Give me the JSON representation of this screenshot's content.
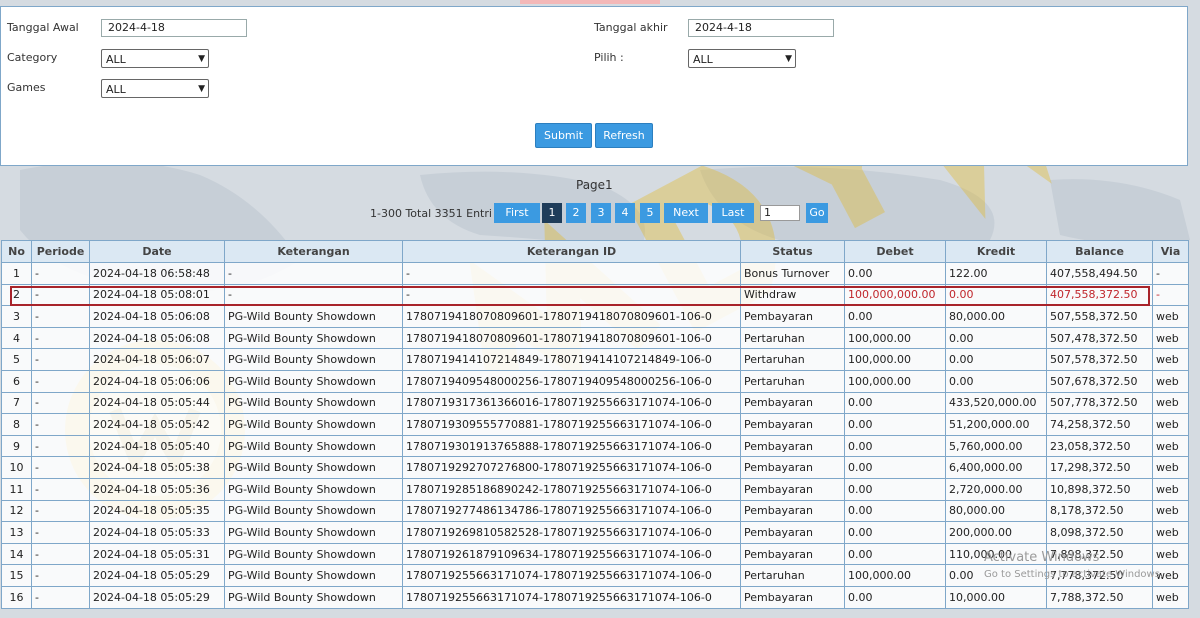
{
  "filters": {
    "tanggal_awal_label": "Tanggal Awal",
    "tanggal_awal_value": "2024-4-18",
    "tanggal_akhir_label": "Tanggal akhir",
    "tanggal_akhir_value": "2024-4-18",
    "category_label": "Category",
    "category_value": "ALL",
    "pilih_label": "Pilih :",
    "pilih_value": "ALL",
    "games_label": "Games",
    "games_value": "ALL",
    "submit_label": "Submit",
    "refresh_label": "Refresh"
  },
  "pagination": {
    "page_label": "Page1",
    "total_label": "1-300 Total 3351 Entri",
    "first": "First",
    "pages": [
      "1",
      "2",
      "3",
      "4",
      "5"
    ],
    "current_page": "1",
    "next": "Next",
    "last": "Last",
    "goto_value": "1",
    "go": "Go"
  },
  "table": {
    "headers": [
      "No",
      "Periode",
      "Date",
      "Keterangan",
      "Keterangan ID",
      "Status",
      "Debet",
      "Kredit",
      "Balance",
      "Via"
    ],
    "rows": [
      [
        "1",
        "-",
        "2024-04-18 06:58:48",
        "-",
        "-",
        "Bonus Turnover",
        "0.00",
        "122.00",
        "407,558,494.50",
        "-"
      ],
      [
        "2",
        "-",
        "2024-04-18 05:08:01",
        "-",
        "-",
        "Withdraw",
        "100,000,000.00",
        "0.00",
        "407,558,372.50",
        "-"
      ],
      [
        "3",
        "-",
        "2024-04-18 05:06:08",
        "PG-Wild Bounty Showdown",
        "1780719418070809601-1780719418070809601-106-0",
        "Pembayaran",
        "0.00",
        "80,000.00",
        "507,558,372.50",
        "web"
      ],
      [
        "4",
        "-",
        "2024-04-18 05:06:08",
        "PG-Wild Bounty Showdown",
        "1780719418070809601-1780719418070809601-106-0",
        "Pertaruhan",
        "100,000.00",
        "0.00",
        "507,478,372.50",
        "web"
      ],
      [
        "5",
        "-",
        "2024-04-18 05:06:07",
        "PG-Wild Bounty Showdown",
        "1780719414107214849-1780719414107214849-106-0",
        "Pertaruhan",
        "100,000.00",
        "0.00",
        "507,578,372.50",
        "web"
      ],
      [
        "6",
        "-",
        "2024-04-18 05:06:06",
        "PG-Wild Bounty Showdown",
        "1780719409548000256-1780719409548000256-106-0",
        "Pertaruhan",
        "100,000.00",
        "0.00",
        "507,678,372.50",
        "web"
      ],
      [
        "7",
        "-",
        "2024-04-18 05:05:44",
        "PG-Wild Bounty Showdown",
        "1780719317361366016-1780719255663171074-106-0",
        "Pembayaran",
        "0.00",
        "433,520,000.00",
        "507,778,372.50",
        "web"
      ],
      [
        "8",
        "-",
        "2024-04-18 05:05:42",
        "PG-Wild Bounty Showdown",
        "1780719309555770881-1780719255663171074-106-0",
        "Pembayaran",
        "0.00",
        "51,200,000.00",
        "74,258,372.50",
        "web"
      ],
      [
        "9",
        "-",
        "2024-04-18 05:05:40",
        "PG-Wild Bounty Showdown",
        "1780719301913765888-1780719255663171074-106-0",
        "Pembayaran",
        "0.00",
        "5,760,000.00",
        "23,058,372.50",
        "web"
      ],
      [
        "10",
        "-",
        "2024-04-18 05:05:38",
        "PG-Wild Bounty Showdown",
        "1780719292707276800-1780719255663171074-106-0",
        "Pembayaran",
        "0.00",
        "6,400,000.00",
        "17,298,372.50",
        "web"
      ],
      [
        "11",
        "-",
        "2024-04-18 05:05:36",
        "PG-Wild Bounty Showdown",
        "1780719285186890242-1780719255663171074-106-0",
        "Pembayaran",
        "0.00",
        "2,720,000.00",
        "10,898,372.50",
        "web"
      ],
      [
        "12",
        "-",
        "2024-04-18 05:05:35",
        "PG-Wild Bounty Showdown",
        "1780719277486134786-1780719255663171074-106-0",
        "Pembayaran",
        "0.00",
        "80,000.00",
        "8,178,372.50",
        "web"
      ],
      [
        "13",
        "-",
        "2024-04-18 05:05:33",
        "PG-Wild Bounty Showdown",
        "1780719269810582528-1780719255663171074-106-0",
        "Pembayaran",
        "0.00",
        "200,000.00",
        "8,098,372.50",
        "web"
      ],
      [
        "14",
        "-",
        "2024-04-18 05:05:31",
        "PG-Wild Bounty Showdown",
        "1780719261879109634-1780719255663171074-106-0",
        "Pembayaran",
        "0.00",
        "110,000.00",
        "7,898,372.50",
        "web"
      ],
      [
        "15",
        "-",
        "2024-04-18 05:05:29",
        "PG-Wild Bounty Showdown",
        "1780719255663171074-1780719255663171074-106-0",
        "Pertaruhan",
        "100,000.00",
        "0.00",
        "7,778,372.50",
        "web"
      ],
      [
        "16",
        "-",
        "2024-04-18 05:05:29",
        "PG-Wild Bounty Showdown",
        "1780719255663171074-1780719255663171074-106-0",
        "Pembayaran",
        "0.00",
        "10,000.00",
        "7,788,372.50",
        "web"
      ]
    ],
    "highlight_row": 2
  },
  "overlay": {
    "activate_title": "Activate Windows",
    "activate_sub": "Go to Settings to activate Windows."
  },
  "colors": {
    "accent": "#3b9ae1",
    "active_page": "#1f3d5a",
    "header_bg": "#dbe8f3",
    "border": "#7fa7c9",
    "highlight": "#c0262c"
  }
}
